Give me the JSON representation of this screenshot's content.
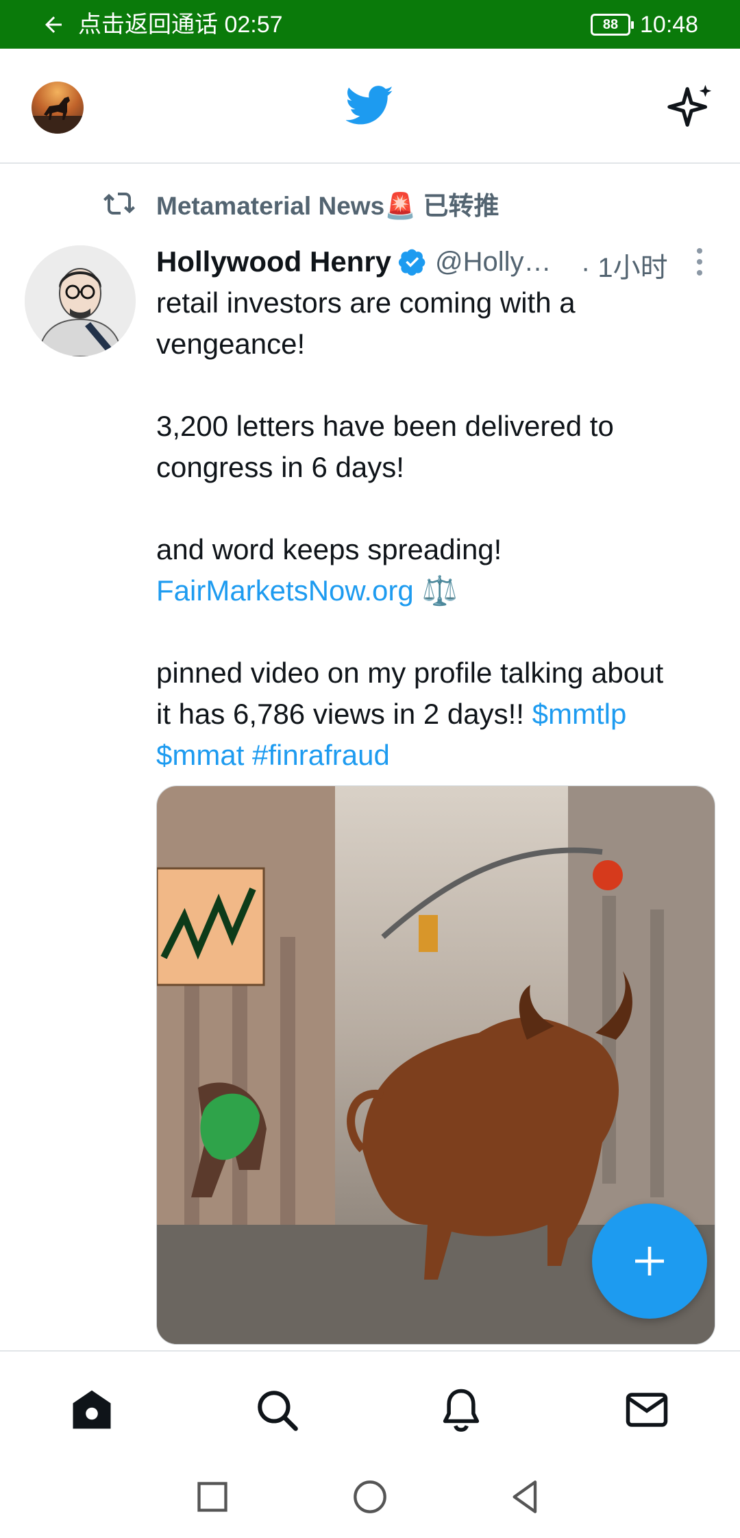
{
  "status_bar": {
    "call_text": "点击返回通话 02:57",
    "battery": "88",
    "time": "10:48",
    "background_color": "#0a7a0a"
  },
  "top_bar": {
    "profile_icon": "user-avatar",
    "logo_icon": "twitter-bird-icon",
    "right_icon": "sparkle-icon"
  },
  "tweet": {
    "retweeted_by": "Metamaterial News🚨 已转推",
    "author_name": "Hollywood Henry",
    "verified": true,
    "handle": "@Holly…",
    "time": "· 1小时",
    "lines": [
      "retail investors are coming with a",
      "vengeance!",
      "",
      "3,200 letters have been delivered to",
      "congress in 6 days!",
      "",
      "and word keeps spreading!"
    ],
    "link_text": "FairMarketsNow.org",
    "link_emoji": "⚖️",
    "lines_2": [
      "pinned video on my profile talking about"
    ],
    "line_last_prefix": "it has 6,786 views in 2 days!! ",
    "tag_1": "$mmtlp",
    "tag_2": "$mmat",
    "tag_3": "#finrafraud"
  },
  "colors": {
    "accent": "#1d9bf0",
    "secondary_text": "#536471",
    "primary_text": "#0f1419"
  },
  "bottom_nav": {
    "items": [
      "home-icon",
      "search-icon",
      "bell-icon",
      "mail-icon"
    ]
  },
  "system_nav": {
    "items": [
      "recents-square-icon",
      "home-circle-icon",
      "back-triangle-icon"
    ]
  }
}
